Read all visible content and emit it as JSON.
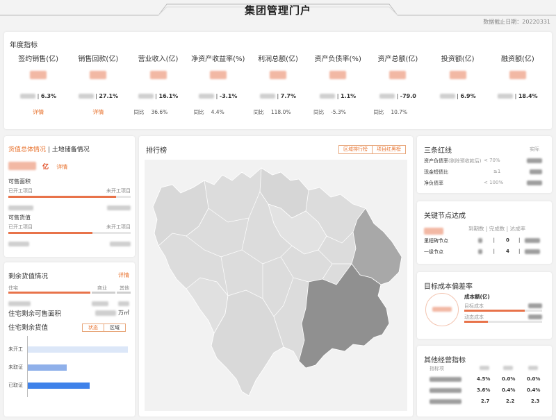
{
  "header": {
    "title": "集团管理门户",
    "cutoff_label": "数据截止日期：",
    "cutoff_date": "20220331"
  },
  "annual": {
    "title": "年度指标",
    "detail_label": "详情",
    "yoy_label": "同比",
    "metrics": [
      {
        "label": "签约销售(亿)",
        "rate": "6.3%",
        "detail": true
      },
      {
        "label": "销售回款(亿)",
        "rate": "27.1%",
        "detail": true
      },
      {
        "label": "营业收入(亿)",
        "rate": "16.1%",
        "yoy": "36.6%"
      },
      {
        "label": "净资产收益率(%)",
        "rate": "-3.1%",
        "yoy": "4.4%"
      },
      {
        "label": "利润总额(亿)",
        "rate": "7.7%",
        "yoy": "118.0%"
      },
      {
        "label": "资产负债率(%)",
        "rate": "1.1%",
        "yoy": "-5.3%"
      },
      {
        "label": "资产总额(亿)",
        "rate": "-79.0",
        "yoy": "10.7%"
      },
      {
        "label": "投资额(亿)",
        "rate": "6.9%"
      },
      {
        "label": "融资额(亿)",
        "rate": "18.4%"
      }
    ]
  },
  "value_card": {
    "tab_active": "货值总体情况",
    "tab_sep": " | ",
    "tab_other": "土地储备情况",
    "unit": "亿",
    "detail": "详情",
    "area_title": "可售面积",
    "started": "已开工项目",
    "not_started": "未开工项目",
    "value_title": "可售货值",
    "area_progress": 0.88,
    "value_progress": 0.69
  },
  "remain_card": {
    "title": "剩余货值情况",
    "detail": "详情",
    "residential": "住宅",
    "commercial": "商业",
    "other": "其他",
    "area_label": "住宅剩余可售面积",
    "area_unit": "万㎡",
    "value_label": "住宅剩余货值",
    "toggle_status": "状态",
    "toggle_region": "区域",
    "bars": [
      {
        "label": "未开工",
        "value": 1.0,
        "color": "#dce7f8"
      },
      {
        "label": "未取证",
        "value": 0.39,
        "color": "#8fb0ea"
      },
      {
        "label": "已取证",
        "value": 0.62,
        "color": "#3f82ea"
      }
    ]
  },
  "ranking": {
    "title": "排行榜",
    "tab_region": "区域排行榜",
    "tab_redblack": "项目红黑榜"
  },
  "redline": {
    "title": "三条红线",
    "actual": "实际",
    "rows": [
      {
        "label": "资产负债率",
        "note": "(剔除预收款后)",
        "threshold": "< 70%"
      },
      {
        "label": "现金短债比",
        "note": "",
        "threshold": "≥1"
      },
      {
        "label": "净负债率",
        "note": "",
        "threshold": "< 100%"
      }
    ]
  },
  "nodes": {
    "title": "关键节点达成",
    "col_due": "到期数",
    "col_done": "完成数",
    "col_rate": "达成率",
    "rows": [
      {
        "label": "里程碑节点",
        "done": "0"
      },
      {
        "label": "一级节点",
        "done": "4"
      }
    ]
  },
  "cost": {
    "title": "目标成本偏差率",
    "amount_label": "成本额(亿)",
    "target": "目标成本",
    "dynamic": "动态成本",
    "target_progress": 0.78,
    "dynamic_progress": 0.3
  },
  "other": {
    "title": "其他经营指标",
    "col_indicator": "指标项",
    "rows": [
      {
        "v1": "4.5%",
        "v2": "0.0%",
        "v3": "0.0%"
      },
      {
        "v1": "3.6%",
        "v2": "0.4%",
        "v3": "0.4%"
      },
      {
        "v1": "2.7",
        "v2": "2.2",
        "v3": "2.3"
      }
    ]
  },
  "colors": {
    "accent": "#e8732f",
    "bar": "#e8734a",
    "map_light": "#dcdcdc",
    "map_mid": "#a8a8a8",
    "map_dark": "#909090"
  }
}
